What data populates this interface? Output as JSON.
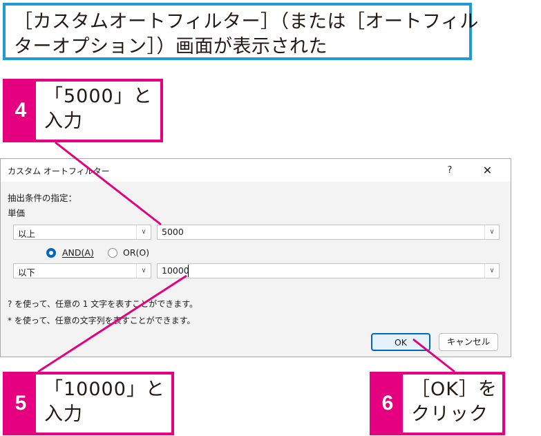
{
  "caption": {
    "line1": "［カスタムオートフィルター］（または［オートフィル",
    "line2": "ターオプション］）画面が表示された"
  },
  "steps": [
    {
      "num": "4",
      "line1": "「5000」と",
      "line2": "入力"
    },
    {
      "num": "5",
      "line1": "「10000」と",
      "line2": "入力"
    },
    {
      "num": "6",
      "line1": "［OK］を",
      "line2": "クリック"
    }
  ],
  "dialog": {
    "title": "カスタム オートフィルター",
    "help": "?",
    "close": "✕",
    "criteria_label": "抽出条件の指定：",
    "field_label": "単価",
    "row1": {
      "operator": "以上",
      "value": "5000"
    },
    "row2": {
      "operator": "以下",
      "value": "10000"
    },
    "and_label": "AND(A)",
    "or_label": "OR(O)",
    "hint1": "? を使って、任意の 1 文字を表すことができます。",
    "hint2": "* を使って、任意の文字列を表すことができます。",
    "ok": "OK",
    "cancel": "キャンセル",
    "dropdown_glyph": "∨"
  },
  "colors": {
    "accent_pink": "#e4007f",
    "accent_blue": "#1f9ad6",
    "win_blue": "#0067c0"
  }
}
